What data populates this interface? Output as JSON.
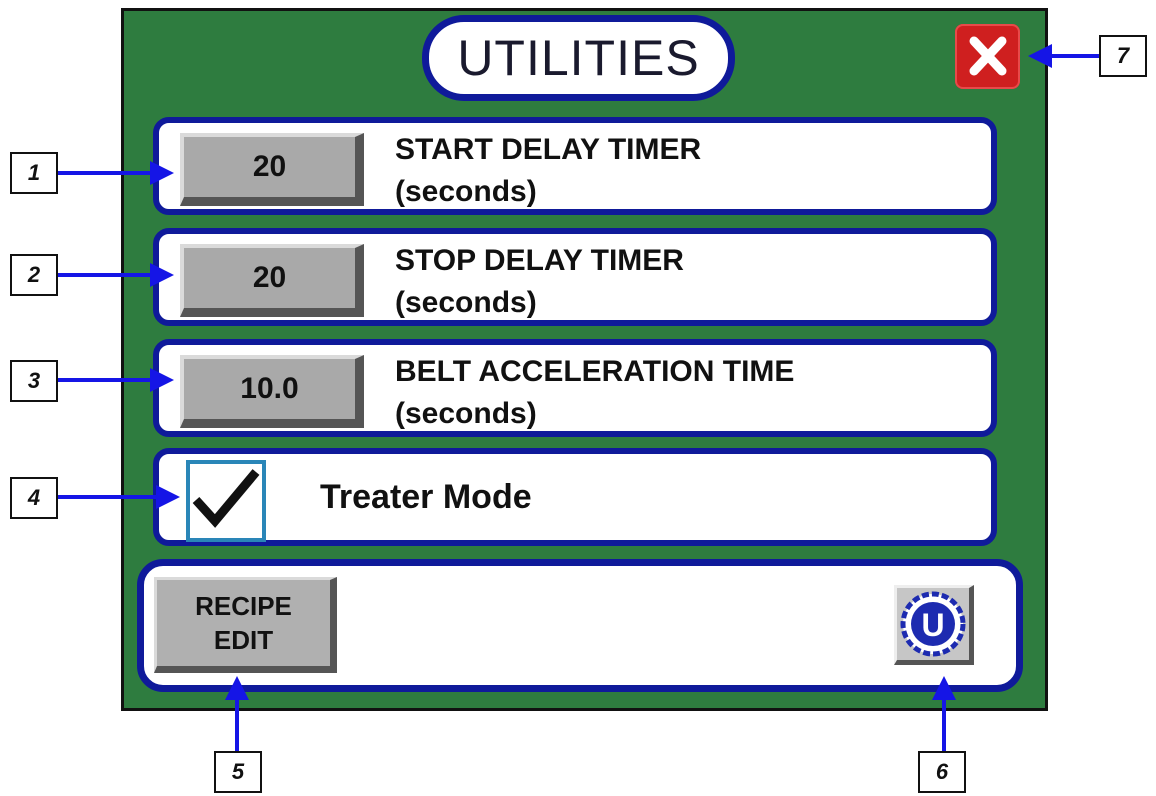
{
  "screen": {
    "title": "UTILITIES",
    "close_icon": "close-x-icon"
  },
  "rows": [
    {
      "value": "20",
      "label_line1": "START DELAY TIMER",
      "label_line2": "(seconds)"
    },
    {
      "value": "20",
      "label_line1": "STOP DELAY TIMER",
      "label_line2": "(seconds)"
    },
    {
      "value": "10.0",
      "label_line1": "BELT ACCELERATION TIME",
      "label_line2": "(seconds)"
    }
  ],
  "treater": {
    "label": "Treater Mode",
    "checked": true
  },
  "bottom": {
    "recipe_line1": "RECIPE",
    "recipe_line2": "EDIT",
    "logo_letter": "U",
    "logo_icon": "brand-logo-icon"
  },
  "callouts": [
    "1",
    "2",
    "3",
    "4",
    "5",
    "6",
    "7"
  ],
  "colors": {
    "background_green": "#2e7c3f",
    "panel_border_blue": "#0f1a9a",
    "arrow_blue": "#1515e6",
    "close_red": "#cf1f1f",
    "button_gray": "#a9a9a9"
  }
}
